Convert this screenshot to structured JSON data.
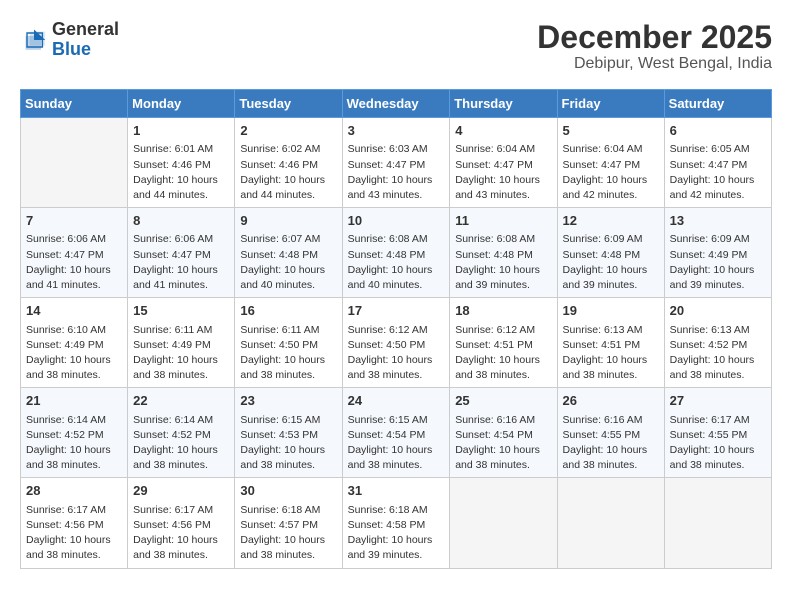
{
  "header": {
    "logo_line1": "General",
    "logo_line2": "Blue",
    "main_title": "December 2025",
    "subtitle": "Debipur, West Bengal, India"
  },
  "calendar": {
    "days_of_week": [
      "Sunday",
      "Monday",
      "Tuesday",
      "Wednesday",
      "Thursday",
      "Friday",
      "Saturday"
    ],
    "weeks": [
      [
        {
          "day": "",
          "empty": true
        },
        {
          "day": "1",
          "sunrise": "6:01 AM",
          "sunset": "4:46 PM",
          "daylight": "10 hours and 44 minutes."
        },
        {
          "day": "2",
          "sunrise": "6:02 AM",
          "sunset": "4:46 PM",
          "daylight": "10 hours and 44 minutes."
        },
        {
          "day": "3",
          "sunrise": "6:03 AM",
          "sunset": "4:47 PM",
          "daylight": "10 hours and 43 minutes."
        },
        {
          "day": "4",
          "sunrise": "6:04 AM",
          "sunset": "4:47 PM",
          "daylight": "10 hours and 43 minutes."
        },
        {
          "day": "5",
          "sunrise": "6:04 AM",
          "sunset": "4:47 PM",
          "daylight": "10 hours and 42 minutes."
        },
        {
          "day": "6",
          "sunrise": "6:05 AM",
          "sunset": "4:47 PM",
          "daylight": "10 hours and 42 minutes."
        }
      ],
      [
        {
          "day": "7",
          "sunrise": "6:06 AM",
          "sunset": "4:47 PM",
          "daylight": "10 hours and 41 minutes."
        },
        {
          "day": "8",
          "sunrise": "6:06 AM",
          "sunset": "4:47 PM",
          "daylight": "10 hours and 41 minutes."
        },
        {
          "day": "9",
          "sunrise": "6:07 AM",
          "sunset": "4:48 PM",
          "daylight": "10 hours and 40 minutes."
        },
        {
          "day": "10",
          "sunrise": "6:08 AM",
          "sunset": "4:48 PM",
          "daylight": "10 hours and 40 minutes."
        },
        {
          "day": "11",
          "sunrise": "6:08 AM",
          "sunset": "4:48 PM",
          "daylight": "10 hours and 39 minutes."
        },
        {
          "day": "12",
          "sunrise": "6:09 AM",
          "sunset": "4:48 PM",
          "daylight": "10 hours and 39 minutes."
        },
        {
          "day": "13",
          "sunrise": "6:09 AM",
          "sunset": "4:49 PM",
          "daylight": "10 hours and 39 minutes."
        }
      ],
      [
        {
          "day": "14",
          "sunrise": "6:10 AM",
          "sunset": "4:49 PM",
          "daylight": "10 hours and 38 minutes."
        },
        {
          "day": "15",
          "sunrise": "6:11 AM",
          "sunset": "4:49 PM",
          "daylight": "10 hours and 38 minutes."
        },
        {
          "day": "16",
          "sunrise": "6:11 AM",
          "sunset": "4:50 PM",
          "daylight": "10 hours and 38 minutes."
        },
        {
          "day": "17",
          "sunrise": "6:12 AM",
          "sunset": "4:50 PM",
          "daylight": "10 hours and 38 minutes."
        },
        {
          "day": "18",
          "sunrise": "6:12 AM",
          "sunset": "4:51 PM",
          "daylight": "10 hours and 38 minutes."
        },
        {
          "day": "19",
          "sunrise": "6:13 AM",
          "sunset": "4:51 PM",
          "daylight": "10 hours and 38 minutes."
        },
        {
          "day": "20",
          "sunrise": "6:13 AM",
          "sunset": "4:52 PM",
          "daylight": "10 hours and 38 minutes."
        }
      ],
      [
        {
          "day": "21",
          "sunrise": "6:14 AM",
          "sunset": "4:52 PM",
          "daylight": "10 hours and 38 minutes."
        },
        {
          "day": "22",
          "sunrise": "6:14 AM",
          "sunset": "4:52 PM",
          "daylight": "10 hours and 38 minutes."
        },
        {
          "day": "23",
          "sunrise": "6:15 AM",
          "sunset": "4:53 PM",
          "daylight": "10 hours and 38 minutes."
        },
        {
          "day": "24",
          "sunrise": "6:15 AM",
          "sunset": "4:54 PM",
          "daylight": "10 hours and 38 minutes."
        },
        {
          "day": "25",
          "sunrise": "6:16 AM",
          "sunset": "4:54 PM",
          "daylight": "10 hours and 38 minutes."
        },
        {
          "day": "26",
          "sunrise": "6:16 AM",
          "sunset": "4:55 PM",
          "daylight": "10 hours and 38 minutes."
        },
        {
          "day": "27",
          "sunrise": "6:17 AM",
          "sunset": "4:55 PM",
          "daylight": "10 hours and 38 minutes."
        }
      ],
      [
        {
          "day": "28",
          "sunrise": "6:17 AM",
          "sunset": "4:56 PM",
          "daylight": "10 hours and 38 minutes."
        },
        {
          "day": "29",
          "sunrise": "6:17 AM",
          "sunset": "4:56 PM",
          "daylight": "10 hours and 38 minutes."
        },
        {
          "day": "30",
          "sunrise": "6:18 AM",
          "sunset": "4:57 PM",
          "daylight": "10 hours and 38 minutes."
        },
        {
          "day": "31",
          "sunrise": "6:18 AM",
          "sunset": "4:58 PM",
          "daylight": "10 hours and 39 minutes."
        },
        {
          "day": "",
          "empty": true
        },
        {
          "day": "",
          "empty": true
        },
        {
          "day": "",
          "empty": true
        }
      ]
    ]
  }
}
